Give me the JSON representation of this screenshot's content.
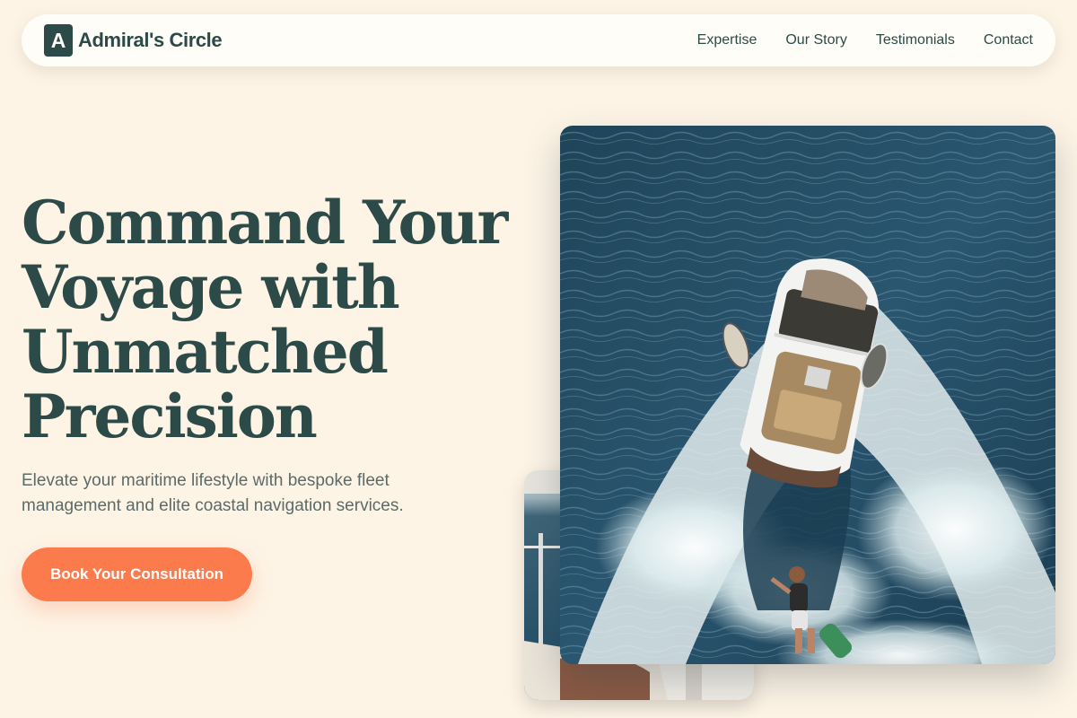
{
  "brand": {
    "icon_letter": "A",
    "name": "Admiral's Circle"
  },
  "nav": {
    "items": [
      {
        "label": "Expertise"
      },
      {
        "label": "Our Story"
      },
      {
        "label": "Testimonials"
      },
      {
        "label": "Contact"
      }
    ]
  },
  "hero": {
    "title_lines": [
      "Command Your",
      "Voyage with",
      "Unmatched",
      "Precision"
    ],
    "subtitle": "Elevate your maritime lifestyle with bespoke fleet management and elite coastal navigation services.",
    "cta_label": "Book Your Consultation"
  },
  "images": {
    "main": "aerial-wakeboat-photo",
    "secondary": "sailboat-deck-photo"
  },
  "colors": {
    "background": "#fdf4e6",
    "primary": "#2c4a48",
    "accent": "#fb7b4c",
    "navbar": "#fffdf8"
  }
}
